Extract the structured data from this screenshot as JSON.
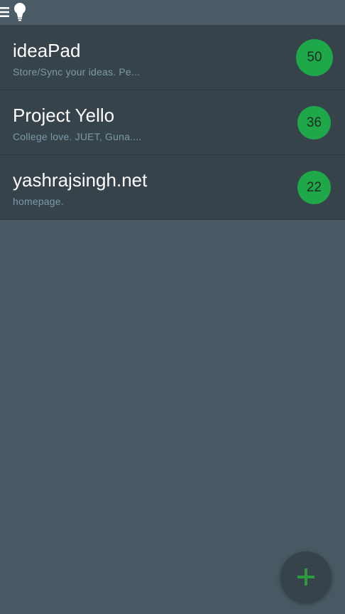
{
  "topbar": {
    "menu_icon": "hamburger-menu-icon",
    "app_icon": "lightbulb-icon"
  },
  "projects": [
    {
      "title": "ideaPad",
      "subtitle": "Store/Sync your ideas. Pe...",
      "count": "50"
    },
    {
      "title": "Project Yello",
      "subtitle": "College love. JUET, Guna....",
      "count": "36"
    },
    {
      "title": "yashrajsingh.net",
      "subtitle": "homepage.",
      "count": "22"
    }
  ],
  "fab": {
    "icon": "plus-icon"
  },
  "colors": {
    "background": "#485963",
    "row": "#36434b",
    "badge": "#1fa84a",
    "subtitle": "#7d9aa9",
    "fab_plus": "#2e9a3c"
  }
}
